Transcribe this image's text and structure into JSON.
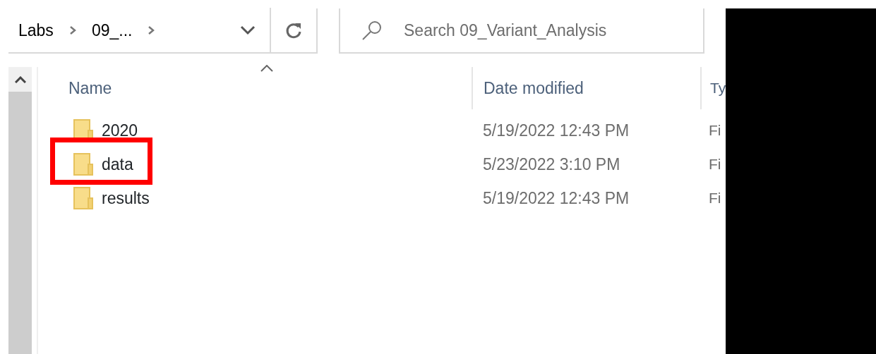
{
  "breadcrumb": [
    "Labs",
    "09_..."
  ],
  "search": {
    "placeholder": "Search 09_Variant_Analysis"
  },
  "columns": [
    {
      "label": "Name",
      "sorted": true
    },
    {
      "label": "Date modified",
      "sorted": false
    },
    {
      "label": "Ty",
      "sorted": false
    }
  ],
  "rows": [
    {
      "name": "2020",
      "date": "5/19/2022 12:43 PM",
      "type": "Fi",
      "highlighted": false
    },
    {
      "name": "data",
      "date": "5/23/2022 3:10 PM",
      "type": "Fi",
      "highlighted": true
    },
    {
      "name": "results",
      "date": "5/19/2022 12:43 PM",
      "type": "Fi",
      "highlighted": false
    }
  ]
}
